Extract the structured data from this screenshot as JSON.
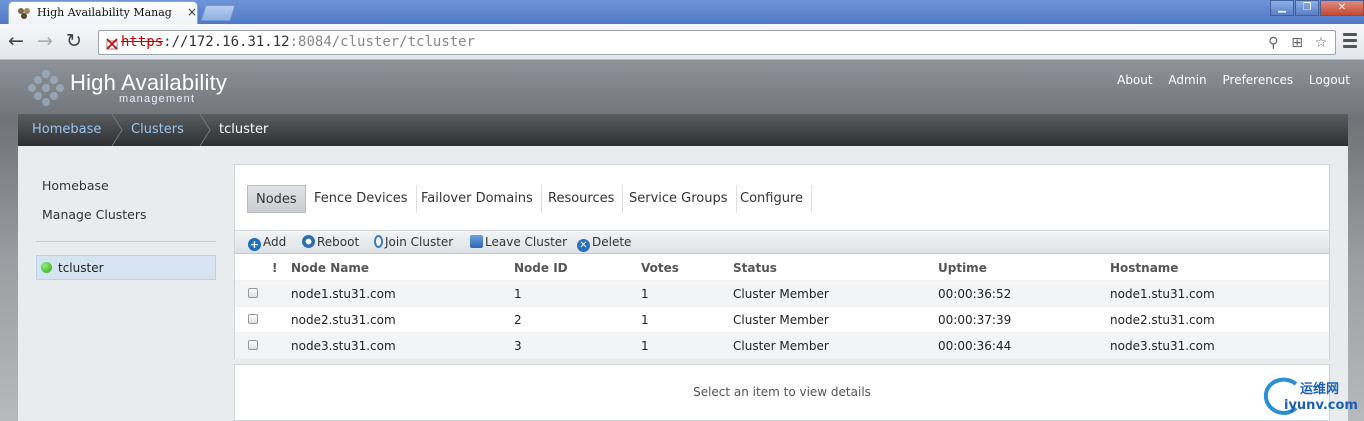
{
  "browser": {
    "tab_title": "High Availability Manag",
    "tab_close": "×",
    "url_scheme": "https",
    "url_sep": "://",
    "url_host": "172.16.31.12",
    "url_path": ":8084/cluster/tcluster"
  },
  "header": {
    "logo_title": "High Availability",
    "logo_subtitle": "management",
    "nav": [
      "About",
      "Admin",
      "Preferences",
      "Logout"
    ]
  },
  "breadcrumb": [
    "Homebase",
    "Clusters",
    "tcluster"
  ],
  "sidebar": {
    "links": [
      "Homebase",
      "Manage Clusters"
    ],
    "cluster": {
      "name": "tcluster",
      "status_color": "#2ea51c"
    }
  },
  "tabs": [
    "Nodes",
    "Fence Devices",
    "Failover Domains",
    "Resources",
    "Service Groups",
    "Configure"
  ],
  "actions": [
    "Add",
    "Reboot",
    "Join Cluster",
    "Leave Cluster",
    "Delete"
  ],
  "table": {
    "columns": [
      "!",
      "Node Name",
      "Node ID",
      "Votes",
      "Status",
      "Uptime",
      "Hostname"
    ],
    "rows": [
      [
        "node1.stu31.com",
        "1",
        "1",
        "Cluster Member",
        "00:00:36:52",
        "node1.stu31.com"
      ],
      [
        "node2.stu31.com",
        "2",
        "1",
        "Cluster Member",
        "00:00:37:39",
        "node2.stu31.com"
      ],
      [
        "node3.stu31.com",
        "3",
        "1",
        "Cluster Member",
        "00:00:36:44",
        "node3.stu31.com"
      ]
    ]
  },
  "detail_placeholder": "Select an item to view details",
  "watermark": {
    "cn": "运维网",
    "en": "iyunv.com"
  }
}
